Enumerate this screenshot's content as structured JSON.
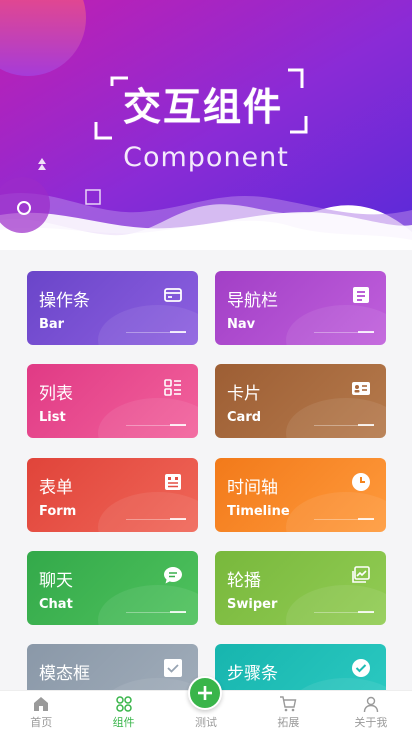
{
  "hero": {
    "title": "交互组件",
    "subtitle": "Component"
  },
  "cards": [
    {
      "title": "操作条",
      "en": "Bar",
      "icon": "card-window-icon",
      "color_from": "#6a45c9",
      "color_to": "#8d60e0"
    },
    {
      "title": "导航栏",
      "en": "Nav",
      "icon": "document-list-icon",
      "color_from": "#a23fc6",
      "color_to": "#c060dc"
    },
    {
      "title": "列表",
      "en": "List",
      "icon": "list-icon",
      "color_from": "#e03a85",
      "color_to": "#f2629c"
    },
    {
      "title": "卡片",
      "en": "Card",
      "icon": "id-card-icon",
      "color_from": "#9d5e34",
      "color_to": "#b57a4c"
    },
    {
      "title": "表单",
      "en": "Form",
      "icon": "form-icon",
      "color_from": "#e0443a",
      "color_to": "#f06658"
    },
    {
      "title": "时间轴",
      "en": "Timeline",
      "icon": "clock-icon",
      "color_from": "#f27a1a",
      "color_to": "#ff9a3c"
    },
    {
      "title": "聊天",
      "en": "Chat",
      "icon": "chat-bubble-icon",
      "color_from": "#33a94a",
      "color_to": "#4fc25d"
    },
    {
      "title": "轮播",
      "en": "Swiper",
      "icon": "image-gallery-icon",
      "color_from": "#78b83c",
      "color_to": "#92cc54"
    },
    {
      "title": "模态框",
      "en": "",
      "icon": "check-box-icon",
      "color_from": "#8a98a8",
      "color_to": "#a2aebb"
    },
    {
      "title": "步骤条",
      "en": "",
      "icon": "check-circle-icon",
      "color_from": "#17b5ae",
      "color_to": "#2ccac2"
    }
  ],
  "tabbar": [
    {
      "label": "首页",
      "icon": "home-icon",
      "active": false
    },
    {
      "label": "组件",
      "icon": "grid-circles-icon",
      "active": true
    },
    {
      "label": "测试",
      "icon": "plus-icon",
      "active": false
    },
    {
      "label": "拓展",
      "icon": "cart-icon",
      "active": false
    },
    {
      "label": "关于我",
      "icon": "user-icon",
      "active": false
    }
  ],
  "accent": "#39b54a"
}
